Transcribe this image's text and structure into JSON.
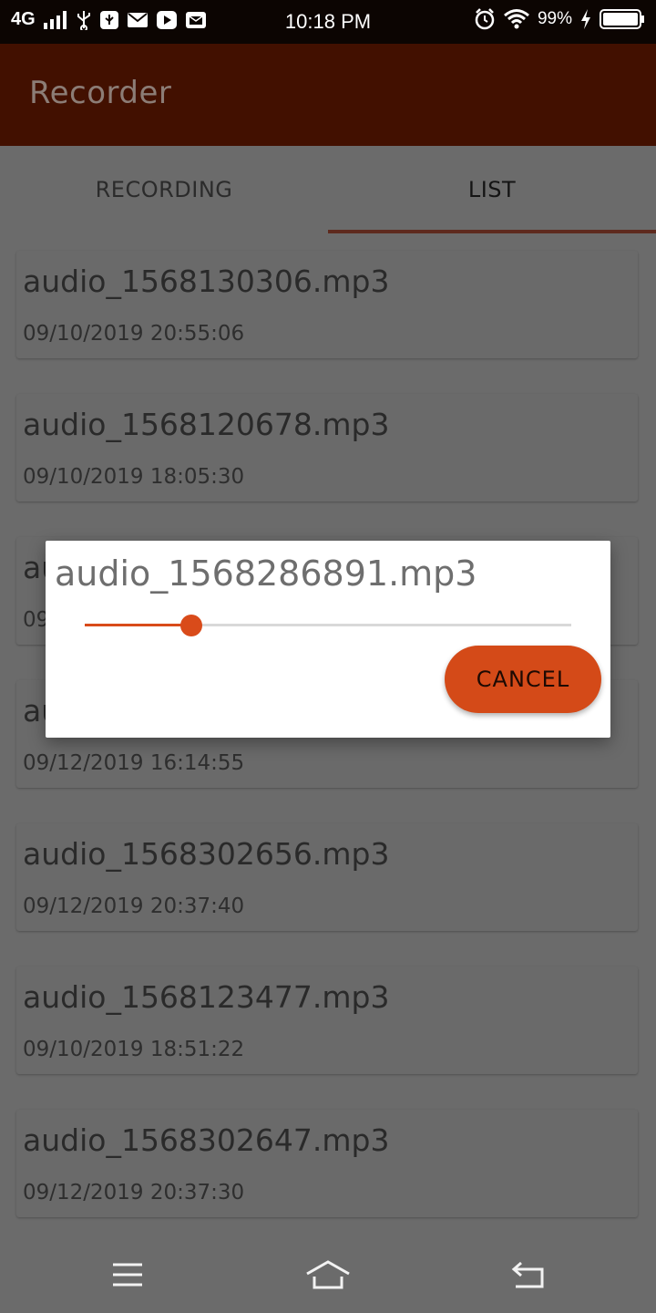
{
  "status_bar": {
    "network": "4G",
    "time": "10:18 PM",
    "battery": "99%",
    "icons": [
      "signal-icon",
      "usb-icon",
      "usb-debug-icon",
      "mail-icon",
      "youtube-icon",
      "message-icon",
      "alarm-icon",
      "wifi-icon",
      "charging-icon",
      "battery-icon"
    ]
  },
  "app_bar": {
    "title": "Recorder"
  },
  "tabs": [
    {
      "label": "RECORDING",
      "selected": false
    },
    {
      "label": "LIST",
      "selected": true
    }
  ],
  "recordings": [
    {
      "name": "audio_1568130306.mp3",
      "date": "09/10/2019 20:55:06"
    },
    {
      "name": "audio_1568120678.mp3",
      "date": "09/10/2019 18:05:30"
    },
    {
      "name": "au",
      "date": "09"
    },
    {
      "name": "au",
      "date": "09/12/2019 16:14:55"
    },
    {
      "name": "audio_1568302656.mp3",
      "date": "09/12/2019 20:37:40"
    },
    {
      "name": "audio_1568123477.mp3",
      "date": "09/10/2019 18:51:22"
    },
    {
      "name": "audio_1568302647.mp3",
      "date": "09/12/2019 20:37:30"
    }
  ],
  "dialog": {
    "title": "audio_1568286891.mp3",
    "progress": 0.22,
    "cancel_label": "CANCEL"
  },
  "colors": {
    "accent": "#d44a18",
    "app_bar": "#421000",
    "status_bar": "#0c0502"
  },
  "nav_bar": {
    "icons": [
      "menu-icon",
      "home-icon",
      "back-icon"
    ]
  }
}
